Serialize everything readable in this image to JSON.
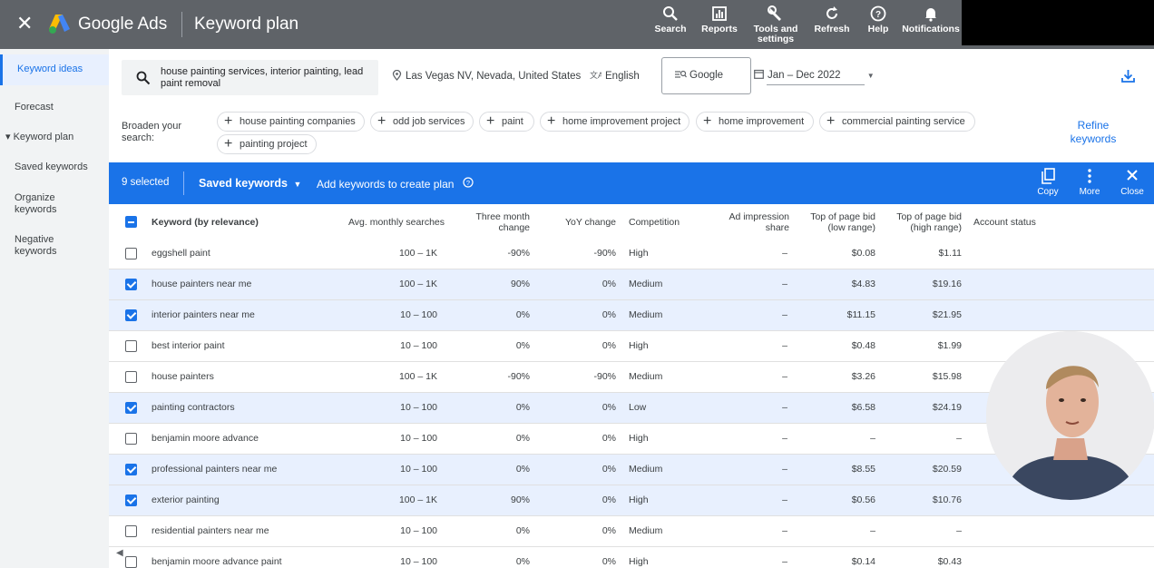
{
  "topbar": {
    "brand": "Google Ads",
    "page_title": "Keyword plan",
    "tools": [
      {
        "label": "Search",
        "icon": "search-icon"
      },
      {
        "label": "Reports",
        "icon": "reports-icon"
      },
      {
        "label": "Tools and settings",
        "icon": "wrench-icon"
      },
      {
        "label": "Refresh",
        "icon": "refresh-icon"
      },
      {
        "label": "Help",
        "icon": "help-icon"
      },
      {
        "label": "Notifications",
        "icon": "bell-icon"
      }
    ]
  },
  "sidebar": {
    "items": [
      {
        "label": "Keyword ideas",
        "active": true
      },
      {
        "label": "Forecast"
      },
      {
        "label": "▾ Keyword plan"
      },
      {
        "label": "Saved keywords"
      },
      {
        "label": "Organize keywords"
      },
      {
        "label": "Negative keywords"
      }
    ]
  },
  "filters": {
    "search_text": "house painting services, interior painting, lead paint removal",
    "location": "Las Vegas NV, Nevada, United States",
    "language": "English",
    "network": "Google",
    "date_range": "Jan – Dec 2022"
  },
  "broaden": {
    "label": "Broaden your search:",
    "chips": [
      "house painting companies",
      "odd job services",
      "paint",
      "home improvement project",
      "home improvement",
      "commercial painting service",
      "painting project"
    ],
    "refine_label": "Refine keywords"
  },
  "selection_bar": {
    "selected": "9 selected",
    "saved_keywords": "Saved keywords",
    "add_to_plan": "Add keywords to create plan",
    "copy": "Copy",
    "more": "More",
    "close": "Close"
  },
  "table": {
    "headers": {
      "keyword": "Keyword (by relevance)",
      "avg": "Avg. monthly searches",
      "three_month": "Three month change",
      "yoy": "YoY change",
      "competition": "Competition",
      "ad_share": "Ad impression share",
      "bid_low": "Top of page bid (low range)",
      "bid_high": "Top of page bid (high range)",
      "account": "Account status"
    },
    "rows": [
      {
        "checked": false,
        "keyword": "eggshell paint",
        "avg": "100 – 1K",
        "three": "-90%",
        "yoy": "-90%",
        "comp": "High",
        "share": "–",
        "low": "$0.08",
        "high": "$1.11"
      },
      {
        "checked": true,
        "keyword": "house painters near me",
        "avg": "100 – 1K",
        "three": "90%",
        "yoy": "0%",
        "comp": "Medium",
        "share": "–",
        "low": "$4.83",
        "high": "$19.16"
      },
      {
        "checked": true,
        "keyword": "interior painters near me",
        "avg": "10 – 100",
        "three": "0%",
        "yoy": "0%",
        "comp": "Medium",
        "share": "–",
        "low": "$11.15",
        "high": "$21.95"
      },
      {
        "checked": false,
        "keyword": "best interior paint",
        "avg": "10 – 100",
        "three": "0%",
        "yoy": "0%",
        "comp": "High",
        "share": "–",
        "low": "$0.48",
        "high": "$1.99"
      },
      {
        "checked": false,
        "keyword": "house painters",
        "avg": "100 – 1K",
        "three": "-90%",
        "yoy": "-90%",
        "comp": "Medium",
        "share": "–",
        "low": "$3.26",
        "high": "$15.98"
      },
      {
        "checked": true,
        "keyword": "painting contractors",
        "avg": "10 – 100",
        "three": "0%",
        "yoy": "0%",
        "comp": "Low",
        "share": "–",
        "low": "$6.58",
        "high": "$24.19"
      },
      {
        "checked": false,
        "keyword": "benjamin moore advance",
        "avg": "10 – 100",
        "three": "0%",
        "yoy": "0%",
        "comp": "High",
        "share": "–",
        "low": "–",
        "high": "–"
      },
      {
        "checked": true,
        "keyword": "professional painters near me",
        "avg": "10 – 100",
        "three": "0%",
        "yoy": "0%",
        "comp": "Medium",
        "share": "–",
        "low": "$8.55",
        "high": "$20.59"
      },
      {
        "checked": true,
        "keyword": "exterior painting",
        "avg": "100 – 1K",
        "three": "90%",
        "yoy": "0%",
        "comp": "High",
        "share": "–",
        "low": "$0.56",
        "high": "$10.76"
      },
      {
        "checked": false,
        "keyword": "residential painters near me",
        "avg": "10 – 100",
        "three": "0%",
        "yoy": "0%",
        "comp": "Medium",
        "share": "–",
        "low": "–",
        "high": "–"
      },
      {
        "checked": false,
        "keyword": "benjamin moore advance paint",
        "avg": "10 – 100",
        "three": "0%",
        "yoy": "0%",
        "comp": "High",
        "share": "–",
        "low": "$0.14",
        "high": "$0.43"
      }
    ]
  },
  "colors": {
    "accent": "#1a73e8",
    "topbar": "#5f6368",
    "selected_row": "#e8f0fe"
  }
}
